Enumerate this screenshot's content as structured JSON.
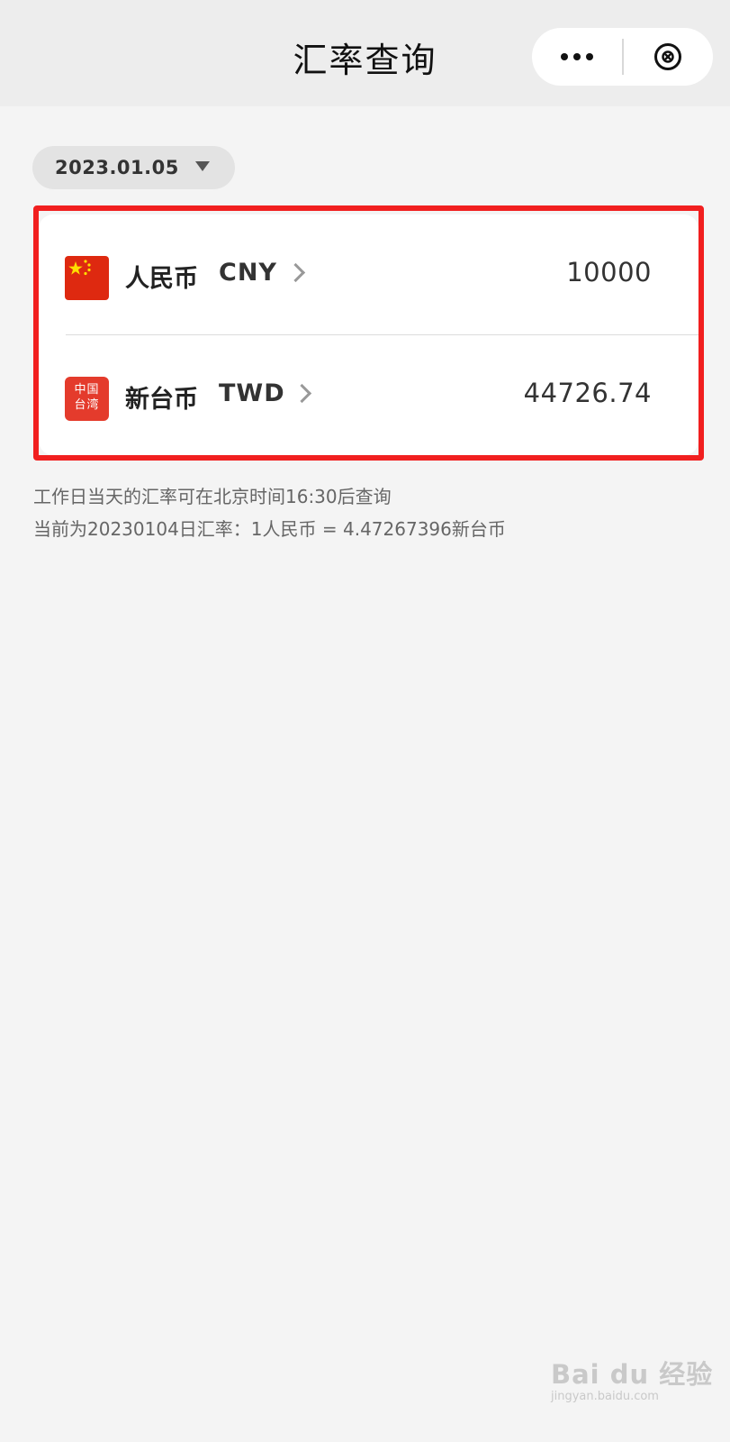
{
  "navbar": {
    "title": "汇率查询",
    "more_icon": "more-dots-icon",
    "close_icon": "close-circle-icon"
  },
  "date_selector": {
    "value": "2023.01.05",
    "arrow_icon": "dropdown-triangle-icon"
  },
  "conversion": {
    "rows": [
      {
        "flag_icon": "china-flag-icon",
        "name": "人民币",
        "code": "CNY",
        "amount": "10000"
      },
      {
        "flag_icon": "taiwan-label-icon",
        "flag_text": "中国台湾",
        "name": "新台币",
        "code": "TWD",
        "amount": "44726.74"
      }
    ]
  },
  "notes": {
    "line1": "工作日当天的汇率可在北京时间16:30后查询",
    "line2": "当前为20230104日汇率：1人民币 = 4.47267396新台币"
  },
  "colors": {
    "highlight_border": "#f11f1f",
    "page_background": "#f4f4f4",
    "navbar_background": "#ededed",
    "flag_red": "#de2910",
    "flag_star": "#ffde00"
  },
  "watermark": {
    "text": "Bai du 经验",
    "sub": "jingyan.baidu.com"
  }
}
